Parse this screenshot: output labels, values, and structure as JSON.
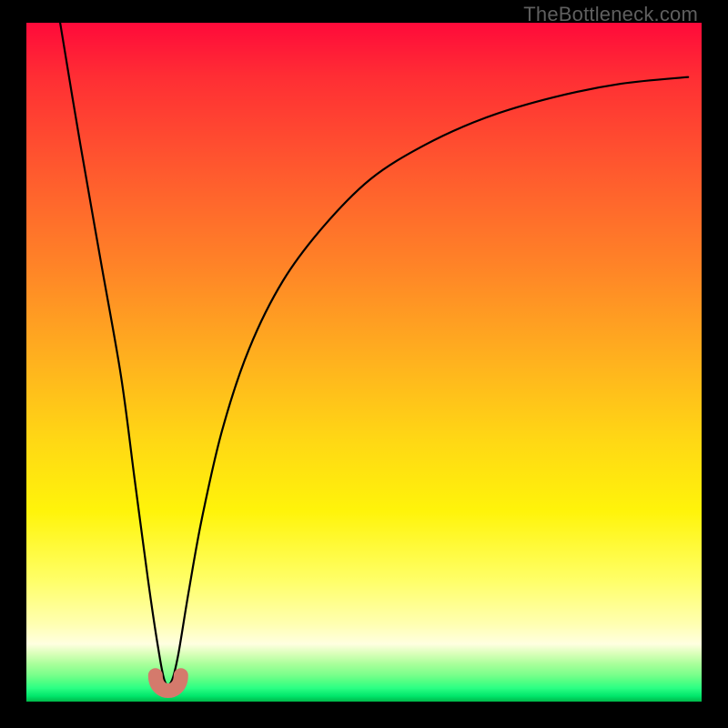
{
  "watermark": "TheBottleneck.com",
  "colors": {
    "frame": "#000000",
    "curve": "#000000",
    "nub": "#d47a6c",
    "gradient_stops": [
      {
        "pos": 0.0,
        "hex": "#ff0a3a"
      },
      {
        "pos": 0.22,
        "hex": "#ff5a2e"
      },
      {
        "pos": 0.5,
        "hex": "#ffb21e"
      },
      {
        "pos": 0.72,
        "hex": "#fff40a"
      },
      {
        "pos": 0.9,
        "hex": "#ffffd0"
      },
      {
        "pos": 0.96,
        "hex": "#7cff8c"
      },
      {
        "pos": 1.0,
        "hex": "#00b84a"
      }
    ]
  },
  "chart_data": {
    "type": "line",
    "title": "",
    "xlabel": "",
    "ylabel": "",
    "x_range": [
      0,
      100
    ],
    "y_range": [
      0,
      100
    ],
    "note": "x and y are normalized 0–100 across the plot area; curve is a V-shaped bottleneck chart with minimum around x≈21, rising steeply to the left edge and asymptotically to the right.",
    "series": [
      {
        "name": "bottleneck-curve",
        "x": [
          5,
          8,
          11,
          14,
          16,
          18,
          19.5,
          20.5,
          21.5,
          22.5,
          24,
          26,
          29,
          33,
          38,
          44,
          51,
          59,
          68,
          78,
          88,
          98
        ],
        "y": [
          100,
          82,
          65,
          48,
          33,
          18,
          8,
          3,
          3,
          7,
          16,
          27,
          40,
          52,
          62,
          70,
          77,
          82,
          86,
          89,
          91,
          92
        ]
      }
    ],
    "marker": {
      "name": "minimum-nub",
      "x": 21,
      "y": 3,
      "shape": "u"
    }
  }
}
